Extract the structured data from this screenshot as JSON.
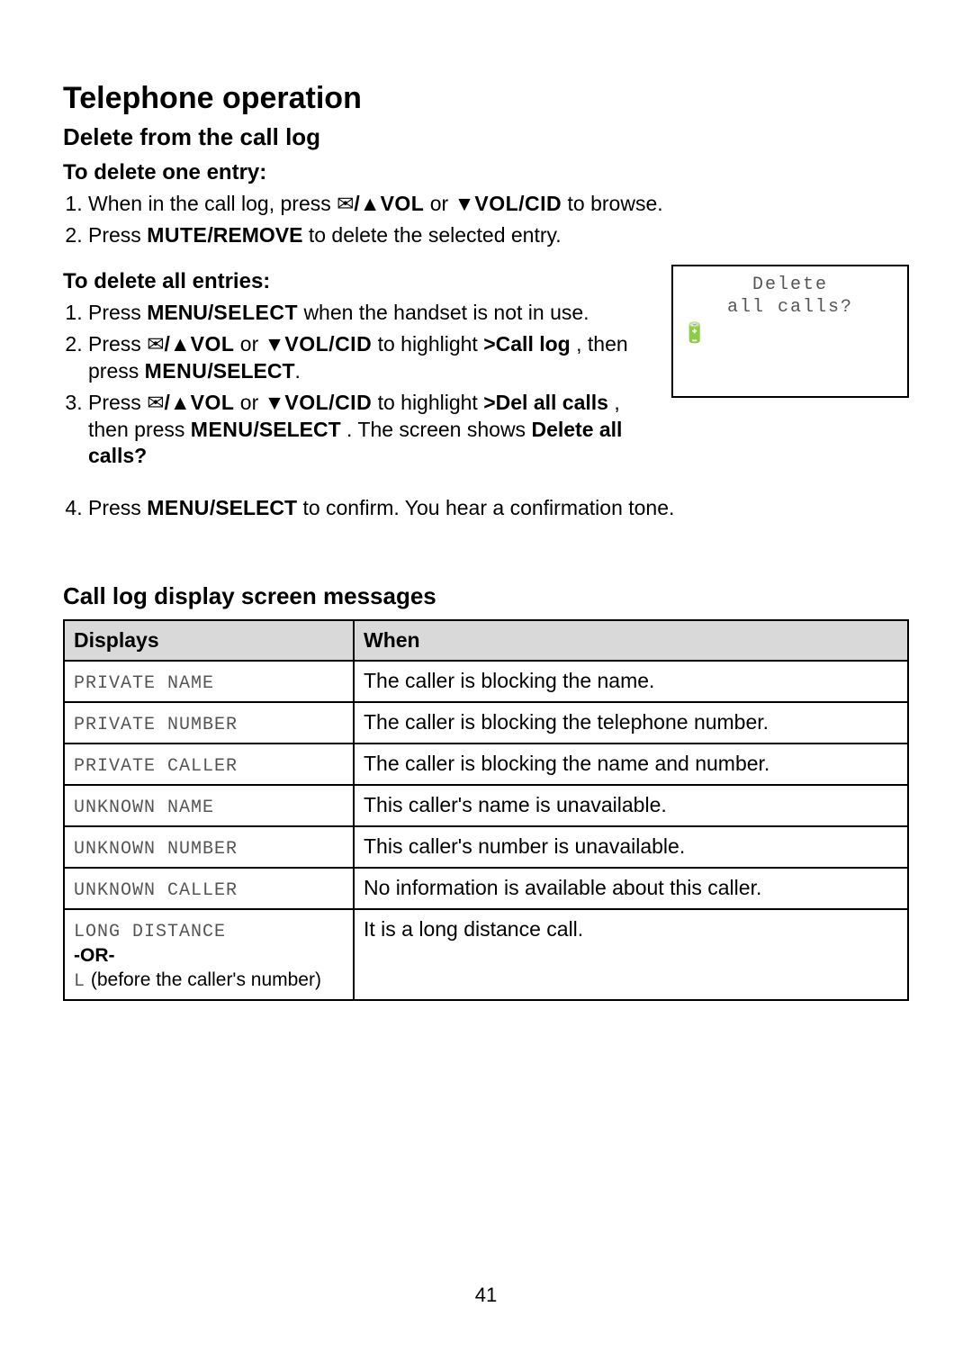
{
  "page_number": "41",
  "headings": {
    "title": "Telephone operation",
    "subtitle": "Delete from the call log",
    "delete_one": "To delete one entry:",
    "delete_all": "To delete all entries:",
    "messages": "Call log display screen messages"
  },
  "keys": {
    "vol": "VOL",
    "vol_cid": "VOL/CID",
    "mute_remove": "MUTE/REMOVE",
    "menu_select_sc": "MENU/SELECT",
    "menu_sc_select": "MENU/SELECT"
  },
  "steps_one": {
    "s1a": "When in the call log, press ",
    "s1b": " or ",
    "s1c": " to browse.",
    "s2a": "Press ",
    "s2b": " to delete the selected entry."
  },
  "steps_all": {
    "s1a": "Press ",
    "s1b": " when the handset is not in use.",
    "s2a": "Press ",
    "s2b": " or ",
    "s2c": " to highlight ",
    "s2d": ">Call log",
    "s2e": ", then press ",
    "s2f": ".",
    "s3a": "Press ",
    "s3b": " or ",
    "s3c": " to highlight ",
    "s3d": ">Del all calls",
    "s3e": ", then press ",
    "s3f": ". The screen shows ",
    "s3g": "Delete all calls?",
    "s4a": "Press ",
    "s4b": " to confirm. You hear a confirmation tone."
  },
  "lcd": {
    "line1": "Delete",
    "line2": "all calls?",
    "battery": "🔋"
  },
  "table": {
    "head_displays": "Displays",
    "head_when": "When",
    "rows": [
      {
        "display": "PRIVATE NAME",
        "when": "The caller is blocking the name."
      },
      {
        "display": "PRIVATE NUMBER",
        "when": "The caller is blocking the telephone number."
      },
      {
        "display": "PRIVATE CALLER",
        "when": "The caller is blocking the name and number."
      },
      {
        "display": "UNKNOWN NAME",
        "when": "This caller's name is unavailable."
      },
      {
        "display": "UNKNOWN NUMBER",
        "when": "This caller's number is unavailable."
      },
      {
        "display": "UNKNOWN CALLER",
        "when": "No information is available about this caller."
      }
    ],
    "last": {
      "display": "LONG DISTANCE",
      "or": "-OR-",
      "l_prefix": "L",
      "l_text": "  (before the caller's number)",
      "when": "It is a long distance call."
    }
  }
}
